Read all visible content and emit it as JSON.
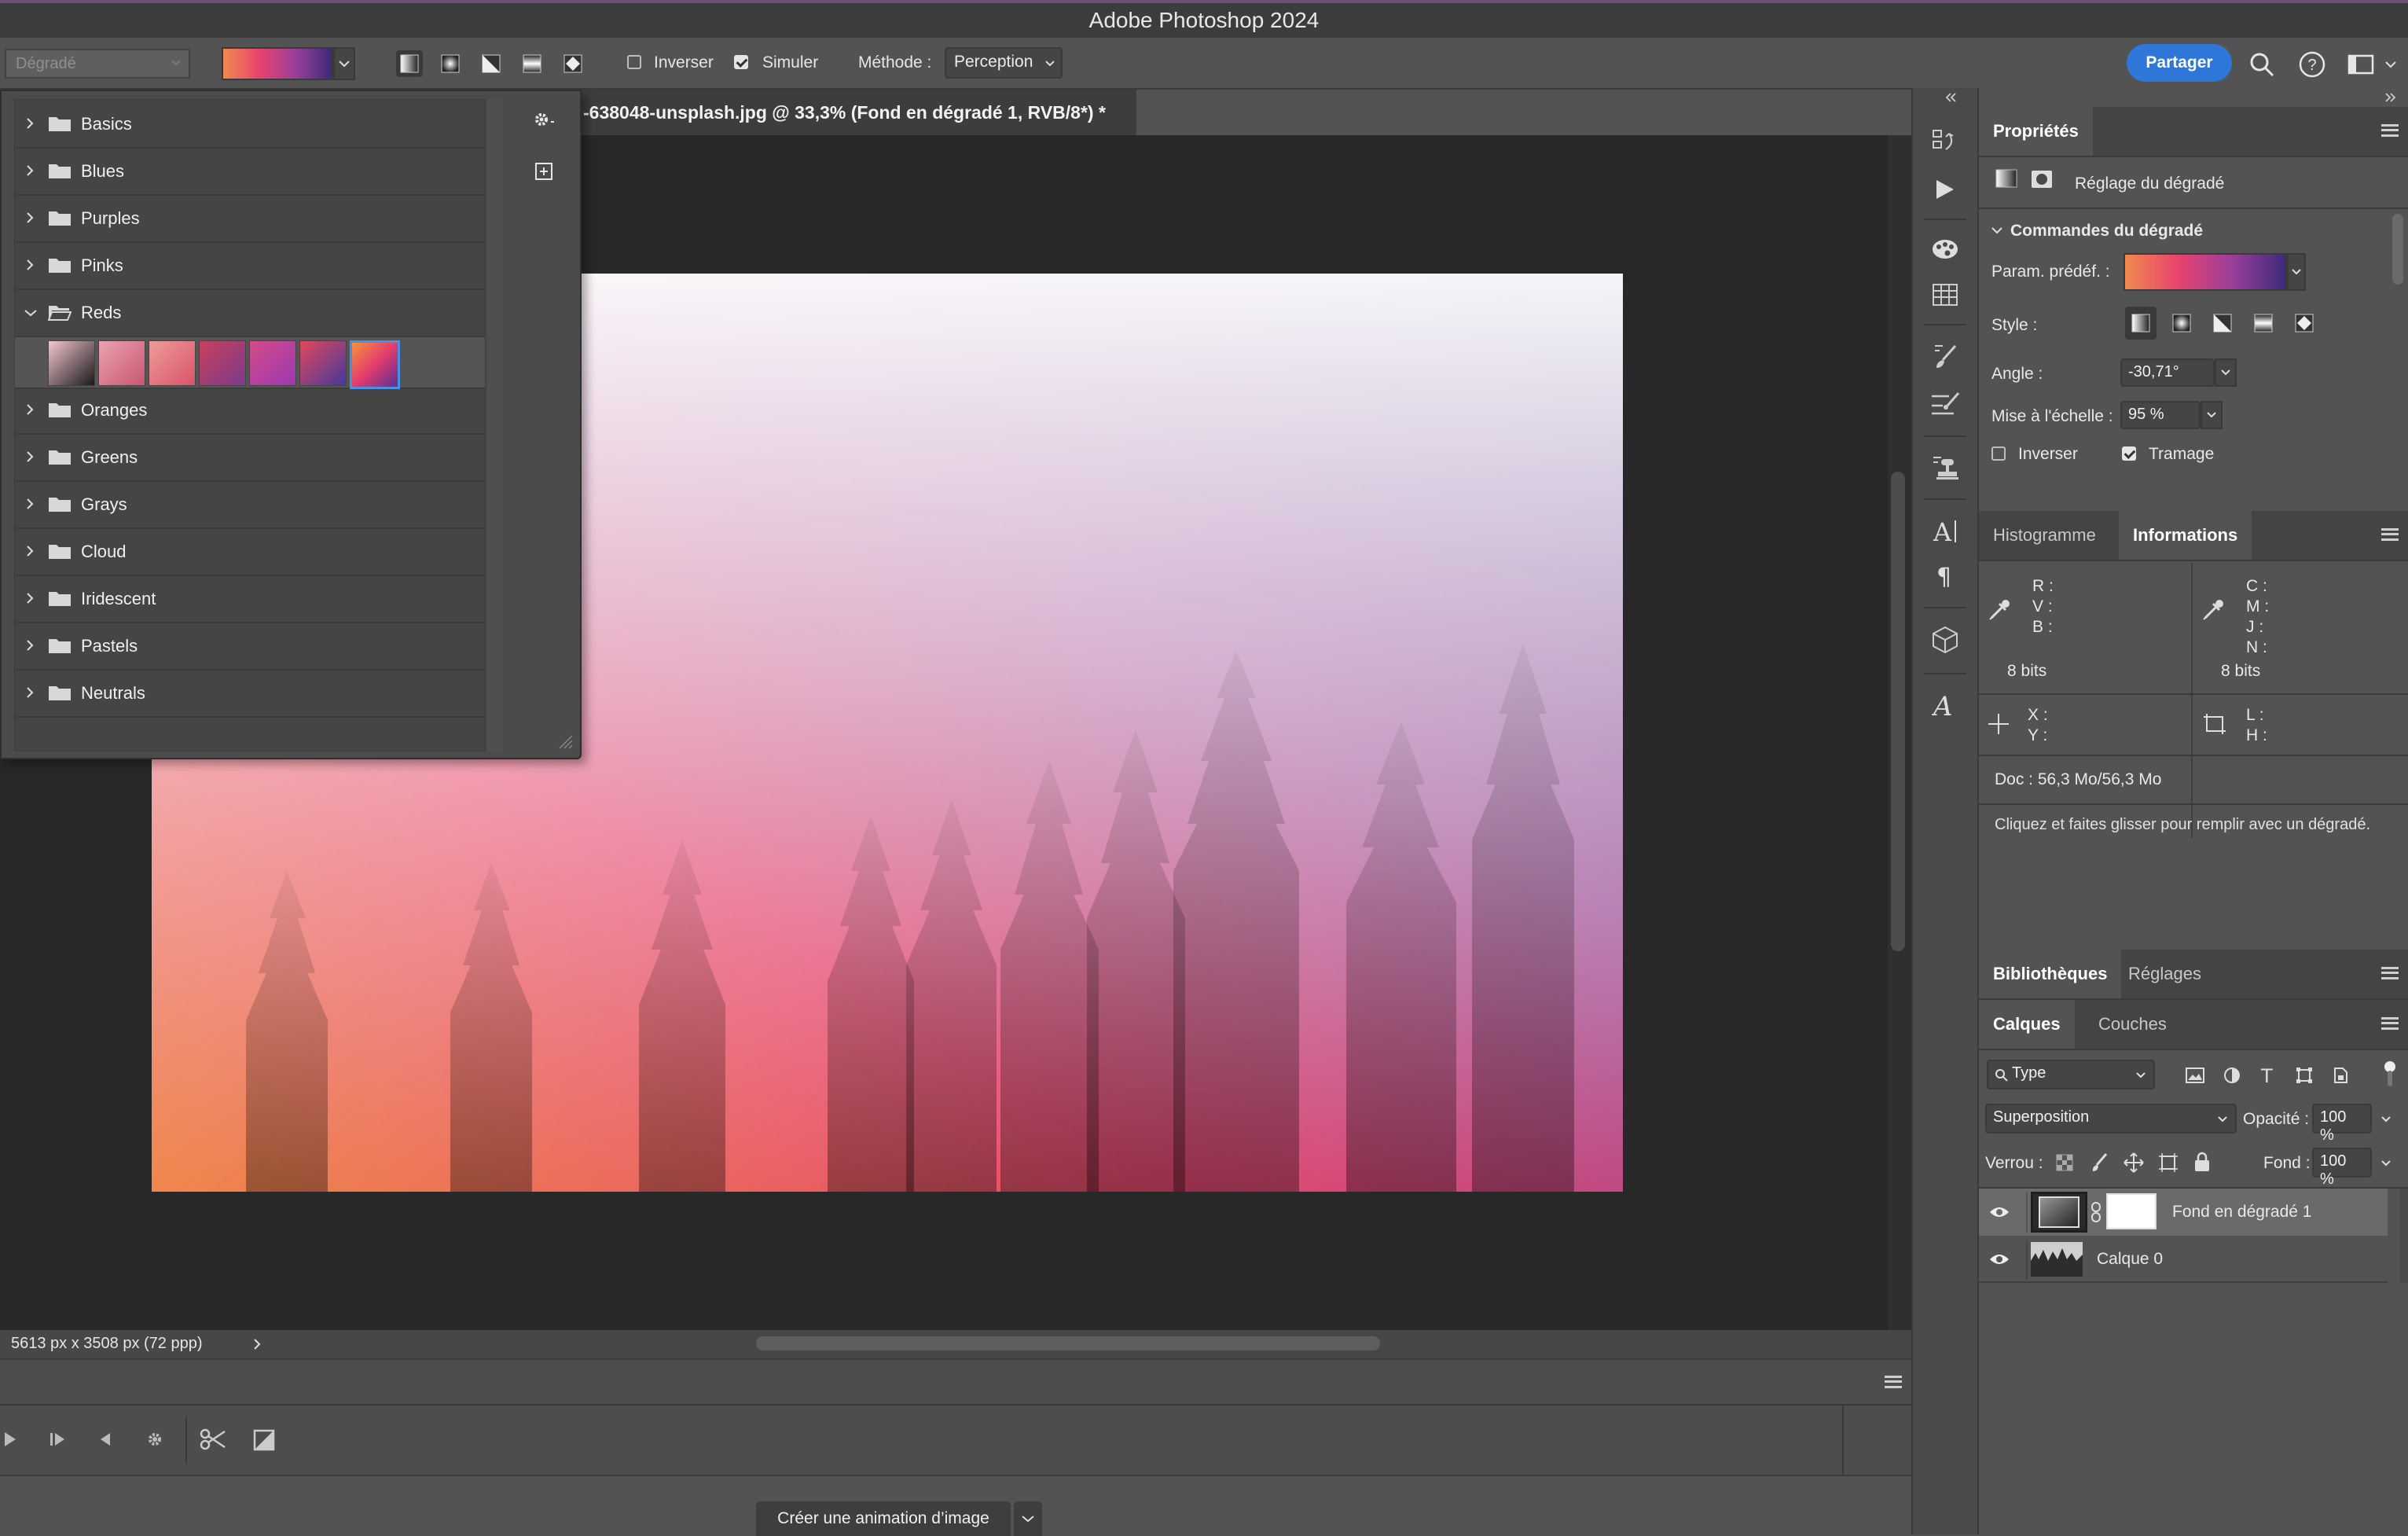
{
  "app": {
    "title": "Adobe Photoshop 2024"
  },
  "options_bar": {
    "tool_select": "Dégradé",
    "gradient_preview_colors": [
      "#f08a4e",
      "#e8436e",
      "#9a3f9a",
      "#3e2a7a"
    ],
    "style_buttons": [
      "linear-gradient-icon",
      "radial-gradient-icon",
      "angle-gradient-icon",
      "reflected-gradient-icon",
      "diamond-gradient-icon"
    ],
    "invert_label": "Inverser",
    "invert_checked": false,
    "simulate_label": "Simuler",
    "simulate_checked": true,
    "method_label": "Méthode :",
    "method_value": "Perception",
    "share_button": "Partager",
    "accent_color": "#2f76d9"
  },
  "presets": {
    "folders": [
      {
        "label": "Basics",
        "expanded": false
      },
      {
        "label": "Blues",
        "expanded": false
      },
      {
        "label": "Purples",
        "expanded": false
      },
      {
        "label": "Pinks",
        "expanded": false
      },
      {
        "label": "Reds",
        "expanded": true
      },
      {
        "label": "Oranges",
        "expanded": false
      },
      {
        "label": "Greens",
        "expanded": false
      },
      {
        "label": "Grays",
        "expanded": false
      },
      {
        "label": "Cloud",
        "expanded": false
      },
      {
        "label": "Iridescent",
        "expanded": false
      },
      {
        "label": "Pastels",
        "expanded": false
      },
      {
        "label": "Neutrals",
        "expanded": false
      }
    ],
    "reds_swatches": [
      [
        "#f3c6d0",
        "#1a1a1a"
      ],
      [
        "#e9a3b0",
        "#c9566f"
      ],
      [
        "#ee9b9a",
        "#d9546a"
      ],
      [
        "#c8405d",
        "#7c3b8c"
      ],
      [
        "#d64a8a",
        "#9a3ab0"
      ],
      [
        "#e2475a",
        "#433a9c"
      ],
      [
        "#f7913e",
        "#e23c6b",
        "#5a3096"
      ]
    ],
    "selected_index": 6
  },
  "document": {
    "tab_title": "-638048-unsplash.jpg @ 33,3% (Fond en dégradé 1, RVB/8*) *",
    "status": "5613 px x 3508 px (72 ppp)"
  },
  "timeline": {
    "create_button": "Créer une animation d’image"
  },
  "properties": {
    "tab": "Propriétés",
    "header": "Réglage du dégradé",
    "section": "Commandes du dégradé",
    "preset_label": "Param. prédéf. :",
    "style_label": "Style :",
    "angle_label": "Angle :",
    "angle_value": "-30,71°",
    "scale_label": "Mise à l'échelle :",
    "scale_value": "95 %",
    "invert_label": "Inverser",
    "invert_checked": false,
    "dither_label": "Tramage",
    "dither_checked": true
  },
  "info_panel": {
    "tabs": [
      "Histogramme",
      "Informations"
    ],
    "active_tab": "Informations",
    "rgb_labels": [
      "R :",
      "V :",
      "B :"
    ],
    "cmyk_labels": [
      "C :",
      "M :",
      "J :",
      "N :"
    ],
    "bits_left": "8 bits",
    "bits_right": "8 bits",
    "xy_labels": [
      "X :",
      "Y :"
    ],
    "lh_labels": [
      "L :",
      "H :"
    ],
    "doc_size": "Doc : 56,3 Mo/56,3 Mo",
    "hint": "Cliquez et faites glisser pour remplir avec un dégradé."
  },
  "libraries": {
    "tabs": [
      "Bibliothèques",
      "Réglages"
    ],
    "active_tab": "Bibliothèques"
  },
  "layers": {
    "tabs": [
      "Calques",
      "Couches"
    ],
    "active_tab": "Calques",
    "filter": "Type",
    "blend_mode": "Superposition",
    "opacity_label": "Opacité :",
    "opacity_value": "100 %",
    "lock_label": "Verrou :",
    "fill_label": "Fond :",
    "fill_value": "100 %",
    "items": [
      {
        "name": "Fond en dégradé 1",
        "visible": true,
        "selected": true
      },
      {
        "name": "Calque 0",
        "visible": true,
        "selected": false
      }
    ]
  }
}
